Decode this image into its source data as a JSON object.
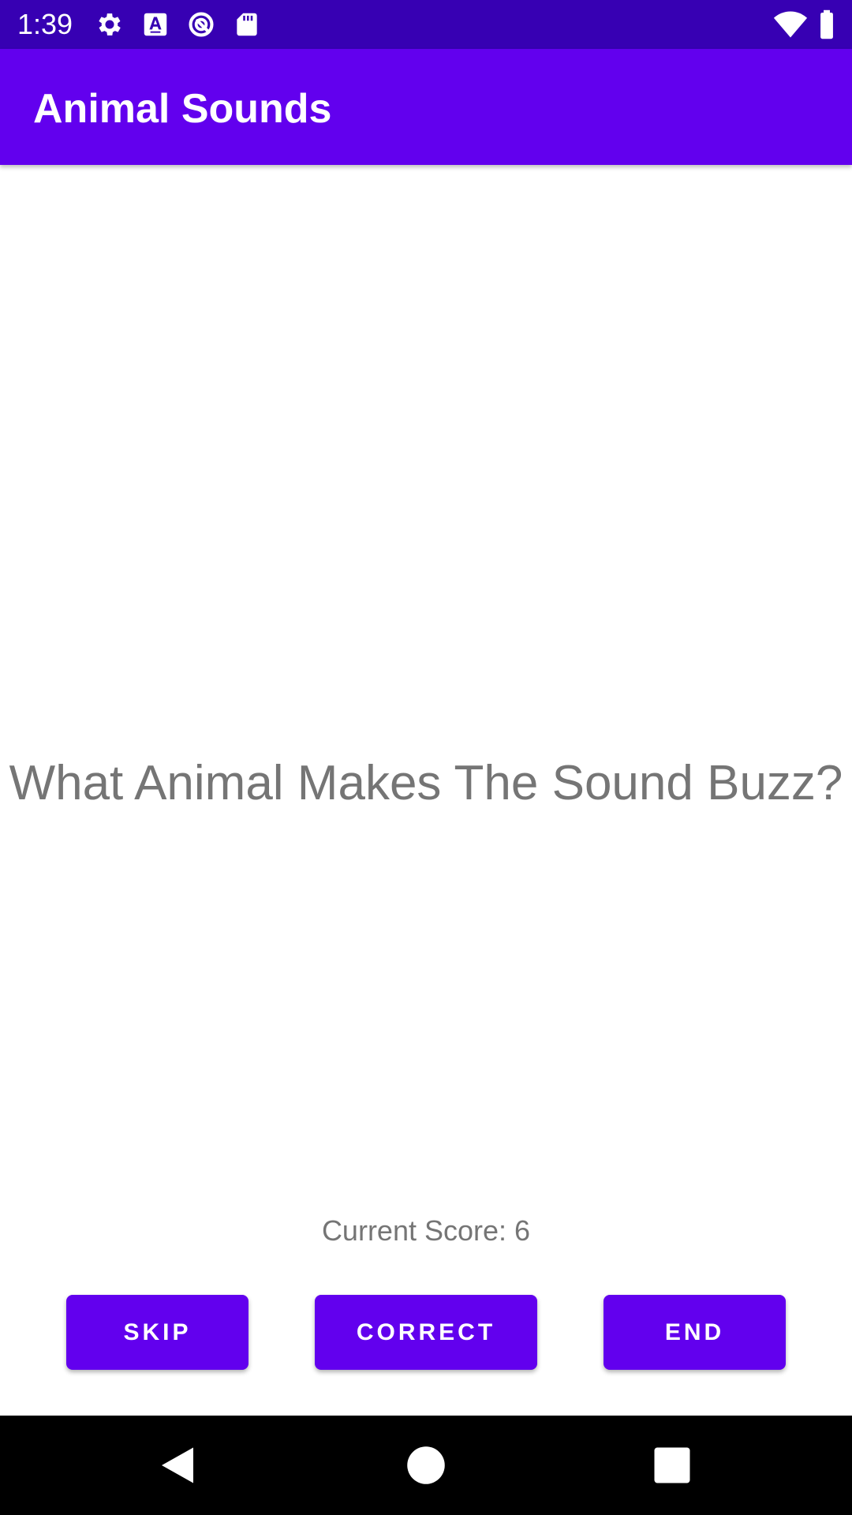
{
  "status_bar": {
    "time": "1:39",
    "left_icons": [
      "gear-icon",
      "font-a-icon",
      "circle-sync-icon",
      "sd-card-icon"
    ],
    "right_icons": [
      "wifi-icon",
      "battery-icon"
    ]
  },
  "app_bar": {
    "title": "Animal Sounds",
    "color": "#6200EE"
  },
  "main": {
    "question": "What Animal Makes The Sound Buzz?",
    "score_text": "Current Score: 6"
  },
  "buttons": {
    "skip_label": "SKIP",
    "correct_label": "CORRECT",
    "end_label": "END",
    "color": "#6200EE"
  },
  "nav_bar": {
    "icons": [
      "back-icon",
      "home-icon",
      "recents-icon"
    ]
  }
}
